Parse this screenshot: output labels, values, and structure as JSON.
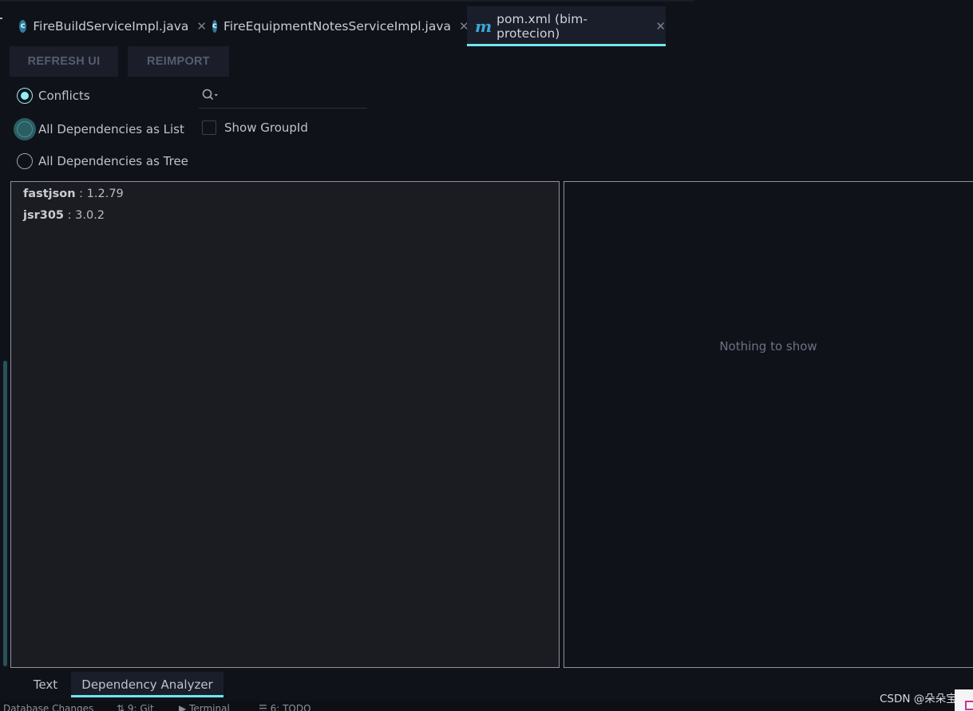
{
  "tabs": [
    {
      "label": "FireBuildServiceImpl.java",
      "icon": "java-class-icon",
      "icon_text": "c"
    },
    {
      "label": "FireEquipmentNotesServiceImpl.java",
      "icon": "java-class-icon",
      "icon_text": "c"
    },
    {
      "label": "pom.xml (bim-protecion)",
      "icon": "maven-icon",
      "icon_text": "m",
      "active": true
    }
  ],
  "toolbar": {
    "refresh_label": "REFRESH UI",
    "reimport_label": "REIMPORT"
  },
  "options": {
    "conflicts": "Conflicts",
    "list": "All Dependencies as List",
    "tree": "All Dependencies as Tree",
    "selected": "conflicts",
    "show_group_id": "Show GroupId",
    "show_group_id_checked": false
  },
  "search": {
    "value": "",
    "icon": "search-icon"
  },
  "dependencies": [
    {
      "name": "fastjson",
      "separator": " : ",
      "version": "1.2.79"
    },
    {
      "name": "jsr305",
      "separator": " : ",
      "version": "3.0.2"
    }
  ],
  "details": {
    "empty_text": "Nothing to show"
  },
  "bottom_tabs": {
    "text": "Text",
    "analyzer": "Dependency Analyzer",
    "active": "analyzer"
  },
  "status_bar": {
    "database": "Database Changes",
    "git": "9: Git",
    "terminal": "Terminal",
    "todo": "6: TODO"
  },
  "watermark": "CSDN @朵朵宝",
  "colors": {
    "accent": "#6ee7ef",
    "background": "#10121a",
    "panel": "#1b1c21"
  }
}
